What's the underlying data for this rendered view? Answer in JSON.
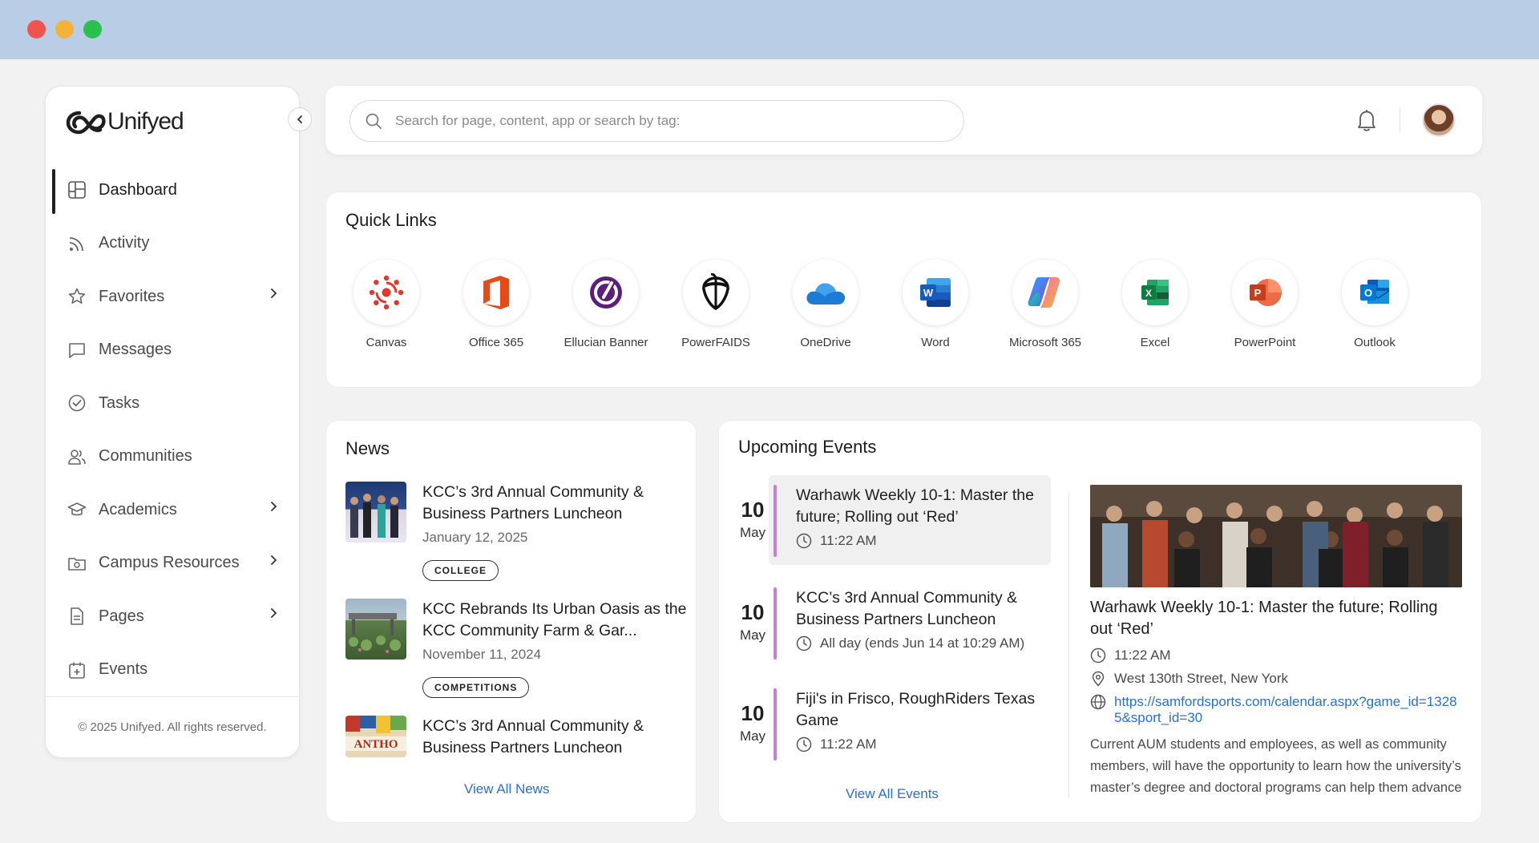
{
  "brand": {
    "name": "Unifyed"
  },
  "sidebar": {
    "items": [
      {
        "label": "Dashboard",
        "icon": "dashboard-icon",
        "active": true
      },
      {
        "label": "Activity",
        "icon": "rss-icon"
      },
      {
        "label": "Favorites",
        "icon": "star-icon",
        "has_submenu": true
      },
      {
        "label": "Messages",
        "icon": "message-icon"
      },
      {
        "label": "Tasks",
        "icon": "check-circle-icon"
      },
      {
        "label": "Communities",
        "icon": "users-icon"
      },
      {
        "label": "Academics",
        "icon": "graduation-cap-icon",
        "has_submenu": true
      },
      {
        "label": "Campus Resources",
        "icon": "folder-image-icon",
        "has_submenu": true
      },
      {
        "label": "Pages",
        "icon": "document-icon",
        "has_submenu": true
      },
      {
        "label": "Events",
        "icon": "calendar-plus-icon"
      }
    ],
    "footer": "© 2025 Unifyed. All rights reserved."
  },
  "search": {
    "placeholder": "Search for page, content, app or search by tag:"
  },
  "quick_links": {
    "title": "Quick Links",
    "items": [
      {
        "label": "Canvas",
        "icon": "canvas-icon"
      },
      {
        "label": "Office 365",
        "icon": "office-365-icon"
      },
      {
        "label": "Ellucian Banner",
        "icon": "ellucian-banner-icon"
      },
      {
        "label": "PowerFAIDS",
        "icon": "powerfaids-icon"
      },
      {
        "label": "OneDrive",
        "icon": "onedrive-icon"
      },
      {
        "label": "Word",
        "icon": "word-icon"
      },
      {
        "label": "Microsoft 365",
        "icon": "microsoft-365-icon"
      },
      {
        "label": "Excel",
        "icon": "excel-icon"
      },
      {
        "label": "PowerPoint",
        "icon": "powerpoint-icon"
      },
      {
        "label": "Outlook",
        "icon": "outlook-icon"
      }
    ]
  },
  "news": {
    "title": "News",
    "items": [
      {
        "title": "KCC’s 3rd Annual Community & Business Partners Luncheon",
        "date": "January  12, 2025",
        "tag": "COLLEGE"
      },
      {
        "title": "KCC Rebrands Its Urban Oasis as the KCC Community Farm & Gar...",
        "date": "November 11, 2024",
        "tag": "COMPETITIONS"
      },
      {
        "title": "KCC’s 3rd Annual Community & Business Partners Luncheon"
      }
    ],
    "view_all": "View All News"
  },
  "events": {
    "title": "Upcoming Events",
    "items": [
      {
        "day": "10",
        "month": "May",
        "title": "Warhawk Weekly 10-1: Master the future; Rolling out ‘Red’",
        "time": "11:22 AM",
        "selected": true
      },
      {
        "day": "10",
        "month": "May",
        "title": "KCC’s 3rd Annual Community & Business Partners Luncheon",
        "time": "All day (ends Jun 14 at 10:29 AM)"
      },
      {
        "day": "10",
        "month": "May",
        "title": "Fiji's in Frisco, RoughRiders Texas Game",
        "time": "11:22 AM"
      }
    ],
    "view_all": "View All Events",
    "detail": {
      "title": "Warhawk Weekly 10-1: Master the future; Rolling out ‘Red’",
      "time": "11:22 AM",
      "location": "West 130th Street, New York",
      "url": "https://samfordsports.com/calendar.aspx?game_id=13285&sport_id=30",
      "description": "Current AUM students and employees, as well as community members, will have the opportunity to learn how the university’s master’s degree and doctoral programs can help them advance their careers."
    }
  }
}
